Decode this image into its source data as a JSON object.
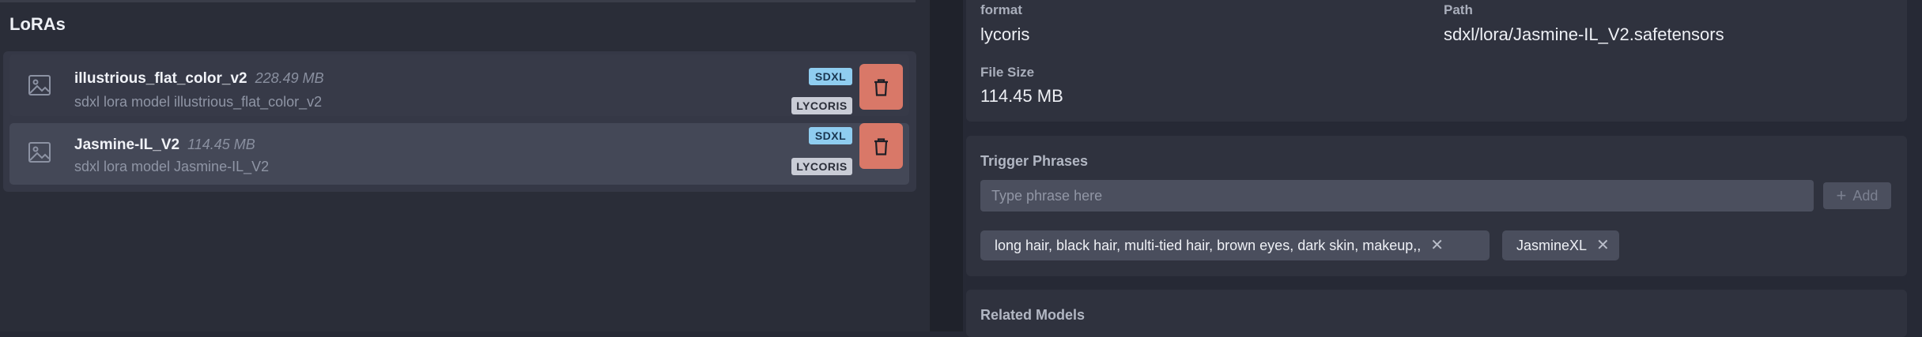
{
  "left": {
    "title": "LoRAs",
    "items": [
      {
        "name": "illustrious_flat_color_v2",
        "size": "228.49 MB",
        "description": "sdxl lora model illustrious_flat_color_v2",
        "base_badge": "SDXL",
        "type_badge": "LYCORIS"
      },
      {
        "name": "Jasmine-IL_V2",
        "size": "114.45 MB",
        "description": "sdxl lora model Jasmine-IL_V2",
        "base_badge": "SDXL",
        "type_badge": "LYCORIS"
      }
    ]
  },
  "details": {
    "format_label": "format",
    "format_value": "lycoris",
    "path_label": "Path",
    "path_value": "sdxl/lora/Jasmine-IL_V2.safetensors",
    "filesize_label": "File Size",
    "filesize_value": "114.45 MB"
  },
  "trigger": {
    "title": "Trigger Phrases",
    "placeholder": "Type phrase here",
    "add_label": "Add",
    "tags": [
      "long hair, black hair, multi-tied hair, brown eyes, dark skin, makeup,,",
      "JasmineXL"
    ]
  },
  "related": {
    "title": "Related Models"
  },
  "colors": {
    "delete": "#d97868",
    "sdxl_badge": "#8fcdf0",
    "lycoris_badge": "#c9ccd6"
  }
}
